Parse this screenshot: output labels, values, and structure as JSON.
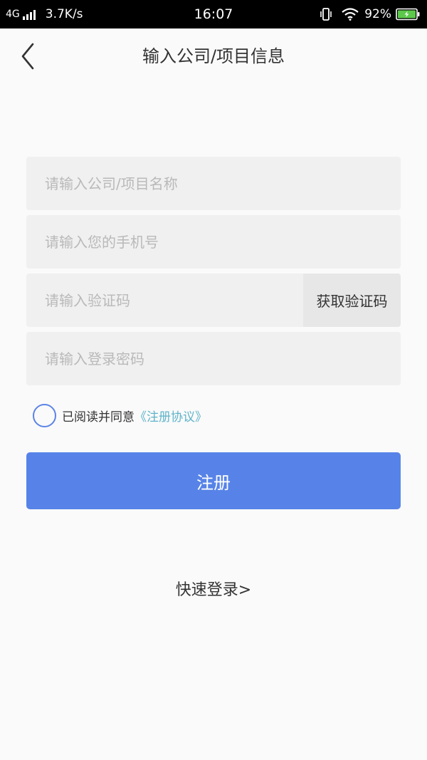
{
  "status_bar": {
    "network": "4G",
    "speed": "3.7K/s",
    "time": "16:07",
    "battery": "92%"
  },
  "header": {
    "title": "输入公司/项目信息"
  },
  "form": {
    "company_placeholder": "请输入公司/项目名称",
    "phone_placeholder": "请输入您的手机号",
    "code_placeholder": "请输入验证码",
    "get_code_label": "获取验证码",
    "password_placeholder": "请输入登录密码"
  },
  "agreement": {
    "text": "已阅读并同意",
    "link": "《注册协议》"
  },
  "register_label": "注册",
  "quick_login_label": "快速登录>",
  "colors": {
    "primary": "#5783e8",
    "link": "#5eb3c9",
    "field_bg": "#f0f0f0"
  }
}
